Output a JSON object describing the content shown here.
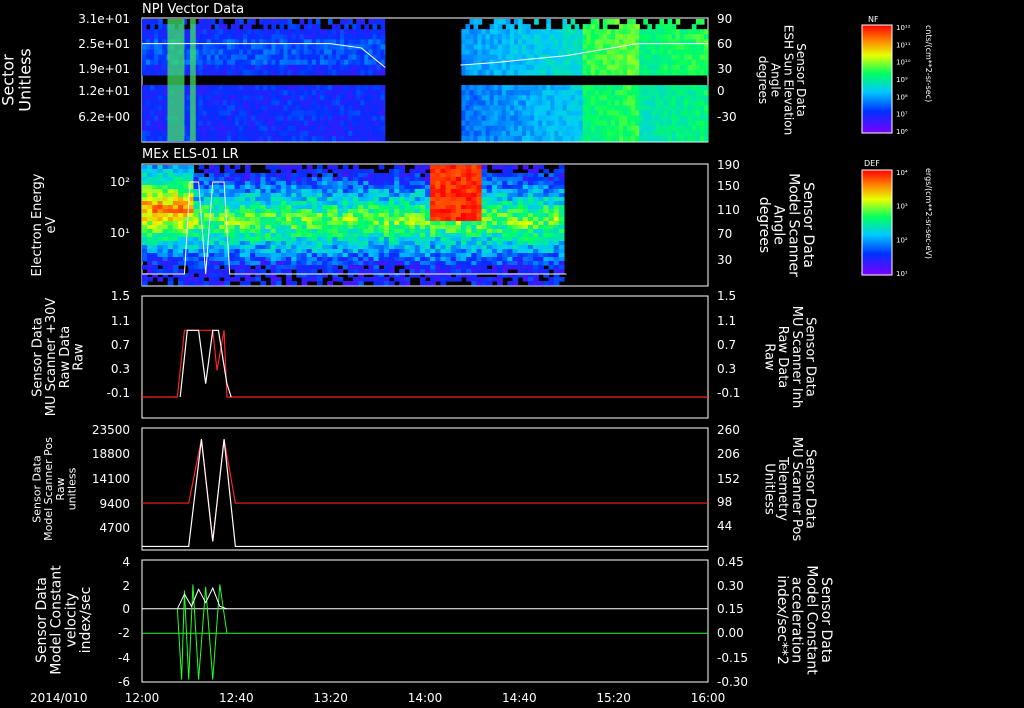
{
  "date_label": "2014/010",
  "time_axis": {
    "ticks": [
      "12:00",
      "12:40",
      "13:20",
      "14:00",
      "14:40",
      "15:20",
      "16:00"
    ]
  },
  "colors": {
    "white": "#ffffff",
    "red": "#ff2020",
    "green": "#20ff20",
    "axis": "#ffffff"
  },
  "chart_data": [
    {
      "type": "heatmap",
      "title": "NPI Vector Data",
      "ylabel": "Sector\nUnitless",
      "yticks": [
        "3.1e+01",
        "2.5e+01",
        "1.9e+01",
        "1.2e+01",
        "6.2e+00"
      ],
      "right_label": "Sensor Data\nESH Sun Elevation\nAngle\ndegrees",
      "right_ticks": [
        "90",
        "60",
        "30",
        "0",
        "-30"
      ],
      "colorbar": {
        "title": "NF",
        "unit": "cnts/(cm**2-sr-sec)",
        "ticks": [
          "10¹²",
          "10¹¹",
          "10¹⁰",
          "10⁹",
          "10⁸",
          "10⁷",
          "10⁶"
        ]
      },
      "line_series": {
        "name": "ESH Sun Elevation Angle",
        "x_hours": [
          12.0,
          12.5,
          13.0,
          13.33,
          13.55,
          13.75,
          14.0,
          14.5,
          15.0,
          15.5,
          16.0
        ],
        "y": [
          60,
          60,
          60,
          60,
          55,
          28,
          32,
          38,
          46,
          60,
          60
        ]
      }
    },
    {
      "type": "heatmap",
      "title": "MEx ELS-01 LR",
      "ylabel": "Electron Energy\neV",
      "yticks": [
        "10²",
        "10¹"
      ],
      "right_label": "Sensor Data\nModel Scanner\nAngle\ndegrees",
      "right_ticks": [
        "190",
        "150",
        "110",
        "70",
        "30"
      ],
      "colorbar": {
        "title": "DEF",
        "unit": "ergs/(cm**2-sr-sec-eV)",
        "ticks": [
          "10⁴",
          "10³",
          "10²",
          "10¹"
        ]
      }
    },
    {
      "type": "line",
      "ylabel": "Sensor Data\nMU Scanner +30V\nRaw Data\nRaw",
      "yticks": [
        "1.5",
        "1.1",
        "0.7",
        "0.3",
        "-0.1"
      ],
      "ylim": [
        -0.3,
        1.5
      ],
      "right_label": "Sensor Data\nMU Scanner Inh\nRaw Data\nRaw",
      "right_ticks": [
        "1.5",
        "1.1",
        "0.7",
        "0.3",
        "-0.1"
      ],
      "series": [
        {
          "name": "MU Scanner Inh Raw Data",
          "color": "red",
          "x_hours": [
            12.0,
            12.25,
            12.3,
            12.5,
            12.53,
            12.58,
            12.6,
            16.0
          ],
          "y": [
            0,
            0,
            1,
            1,
            0.4,
            1,
            0,
            0
          ]
        }
      ]
    },
    {
      "type": "line",
      "ylabel": "Sensor Data\nModel Scanner Pos\nRaw\nunitless",
      "yticks": [
        "23500",
        "18800",
        "14100",
        "9400",
        "4700"
      ],
      "ylim": [
        0,
        23500
      ],
      "right_label": "Sensor Data\nMU Scanner Pos\nTelemetry\nUnitless",
      "right_ticks": [
        "260",
        "206",
        "152",
        "98",
        "44"
      ],
      "series": [
        {
          "name": "MU Scanner Pos Telemetry",
          "color": "red",
          "x_hours": [
            12.0,
            12.33,
            12.42,
            12.5,
            12.58,
            12.66,
            16.0
          ],
          "y": [
            9000,
            9000,
            21500,
            1500,
            21500,
            9000,
            9000
          ]
        }
      ]
    },
    {
      "type": "line",
      "ylabel": "Sensor Data\nModel Constant\nvelocity\nindex/sec",
      "yticks": [
        "4",
        "2",
        "0",
        "-2",
        "-4",
        "-6"
      ],
      "ylim": [
        -6,
        4
      ],
      "right_label": "Sensor Data\nModel Constant\nacceleration\nindex/sec**2",
      "right_ticks": [
        "0.45",
        "0.30",
        "0.15",
        "0.00",
        "-0.15",
        "-0.30"
      ],
      "series": [
        {
          "name": "Model Constant acceleration",
          "color": "green",
          "x_hours": [
            12.0,
            12.5,
            16.0
          ],
          "y": [
            0.0,
            0.0,
            0.0
          ]
        }
      ]
    }
  ]
}
